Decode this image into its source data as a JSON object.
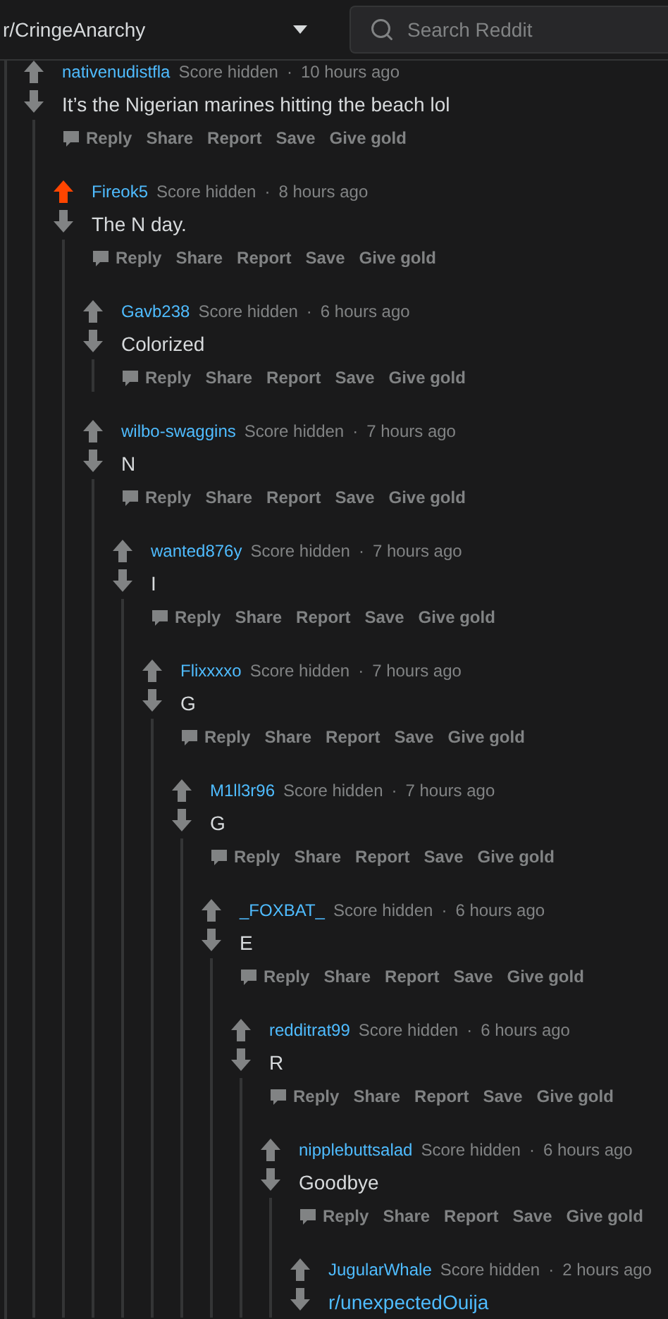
{
  "header": {
    "subreddit": "r/CringeAnarchy",
    "search": {
      "placeholder": "Search Reddit"
    },
    "separator": "·"
  },
  "comments": [
    {
      "author": "nativenudistfla",
      "score": "Score hidden",
      "time": "10 hours ago",
      "upvoted": false,
      "kind": "text",
      "body": "It’s the Nigerian marines hitting the beach lol",
      "actions": [
        "Reply",
        "Share",
        "Report",
        "Save",
        "Give gold"
      ],
      "children": [
        {
          "author": "Fireok5",
          "score": "Score hidden",
          "time": "8 hours ago",
          "upvoted": true,
          "kind": "text",
          "body": "The N day.",
          "actions": [
            "Reply",
            "Share",
            "Report",
            "Save",
            "Give gold"
          ],
          "children": [
            {
              "author": "Gavb238",
              "score": "Score hidden",
              "time": "6 hours ago",
              "upvoted": false,
              "kind": "text",
              "body": "Colorized",
              "actions": [
                "Reply",
                "Share",
                "Report",
                "Save",
                "Give gold"
              ]
            },
            {
              "author": "wilbo-swaggins",
              "score": "Score hidden",
              "time": "7 hours ago",
              "upvoted": false,
              "kind": "text",
              "body": "N",
              "actions": [
                "Reply",
                "Share",
                "Report",
                "Save",
                "Give gold"
              ],
              "children": [
                {
                  "author": "wanted876y",
                  "score": "Score hidden",
                  "time": "7 hours ago",
                  "upvoted": false,
                  "kind": "text",
                  "body": "I",
                  "actions": [
                    "Reply",
                    "Share",
                    "Report",
                    "Save",
                    "Give gold"
                  ],
                  "children": [
                    {
                      "author": "Flixxxxo",
                      "score": "Score hidden",
                      "time": "7 hours ago",
                      "upvoted": false,
                      "kind": "text",
                      "body": "G",
                      "actions": [
                        "Reply",
                        "Share",
                        "Report",
                        "Save",
                        "Give gold"
                      ],
                      "children": [
                        {
                          "author": "M1ll3r96",
                          "score": "Score hidden",
                          "time": "7 hours ago",
                          "upvoted": false,
                          "kind": "text",
                          "body": "G",
                          "actions": [
                            "Reply",
                            "Share",
                            "Report",
                            "Save",
                            "Give gold"
                          ],
                          "children": [
                            {
                              "author": "_FOXBAT_",
                              "score": "Score hidden",
                              "time": "6 hours ago",
                              "upvoted": false,
                              "kind": "text",
                              "body": "E",
                              "actions": [
                                "Reply",
                                "Share",
                                "Report",
                                "Save",
                                "Give gold"
                              ],
                              "children": [
                                {
                                  "author": "redditrat99",
                                  "score": "Score hidden",
                                  "time": "6 hours ago",
                                  "upvoted": false,
                                  "kind": "text",
                                  "body": "R",
                                  "actions": [
                                    "Reply",
                                    "Share",
                                    "Report",
                                    "Save",
                                    "Give gold"
                                  ],
                                  "children": [
                                    {
                                      "author": "nipplebuttsalad",
                                      "score": "Score hidden",
                                      "time": "6 hours ago",
                                      "upvoted": false,
                                      "kind": "text",
                                      "body": "Goodbye",
                                      "actions": [
                                        "Reply",
                                        "Share",
                                        "Report",
                                        "Save",
                                        "Give gold"
                                      ],
                                      "children": [
                                        {
                                          "author": "JugularWhale",
                                          "score": "Score hidden",
                                          "time": "2 hours ago",
                                          "upvoted": false,
                                          "kind": "link",
                                          "body": "r/unexpectedOuija"
                                        }
                                      ]
                                    }
                                  ]
                                }
                              ]
                            }
                          ]
                        }
                      ]
                    }
                  ]
                }
              ]
            }
          ]
        }
      ]
    }
  ]
}
